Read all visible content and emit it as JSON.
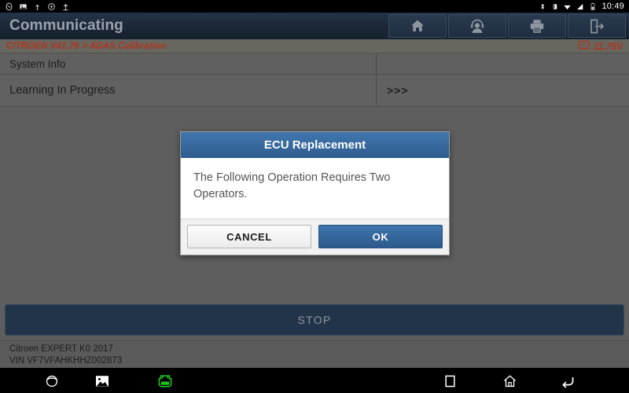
{
  "statusbar": {
    "left_icons": [
      "compass-icon",
      "photo-icon",
      "usb-icon",
      "sync-icon",
      "upload-icon"
    ],
    "right_icons": [
      "bluetooth-icon",
      "vibrate-icon",
      "wifi-icon",
      "signal-icon",
      "battery-icon"
    ],
    "clock": "10:49"
  },
  "appbar": {
    "title": "Communicating",
    "actions": [
      {
        "name": "home-button",
        "icon": "home-icon"
      },
      {
        "name": "support-button",
        "icon": "headset-person-icon"
      },
      {
        "name": "print-button",
        "icon": "printer-icon"
      },
      {
        "name": "exit-button",
        "icon": "exit-icon"
      }
    ]
  },
  "breadcrumb": {
    "path": "CITROEN V41.76 > ADAS Calibration",
    "battery_icon": "battery-voltage-icon",
    "voltage": "11.75V",
    "accent_color": "#b0341e"
  },
  "table": {
    "rows": [
      {
        "label": "System Info",
        "value": "",
        "type": "header"
      },
      {
        "label": "Learning In Progress",
        "value": ">>>",
        "type": "item"
      }
    ]
  },
  "dialog": {
    "title": "ECU Replacement",
    "message": "The Following Operation Requires Two Operators.",
    "cancel_label": "CANCEL",
    "ok_label": "OK",
    "title_color": "#2f5c8f",
    "ok_color": "#2d5a8c"
  },
  "stop_button": {
    "label": "STOP"
  },
  "footer": {
    "vehicle": "Citroen EXPERT K0 2017",
    "vin": "VIN VF7VFAHKHHZ002873"
  },
  "navbar": {
    "items": [
      {
        "name": "browser-icon",
        "label": "browser"
      },
      {
        "name": "gallery-icon",
        "label": "gallery"
      },
      {
        "name": "vci-icon",
        "label": "VCI",
        "color": "#21c521"
      },
      {
        "name": "recents-icon",
        "label": "recents"
      },
      {
        "name": "home-icon",
        "label": "home"
      },
      {
        "name": "back-icon",
        "label": "back"
      }
    ]
  }
}
